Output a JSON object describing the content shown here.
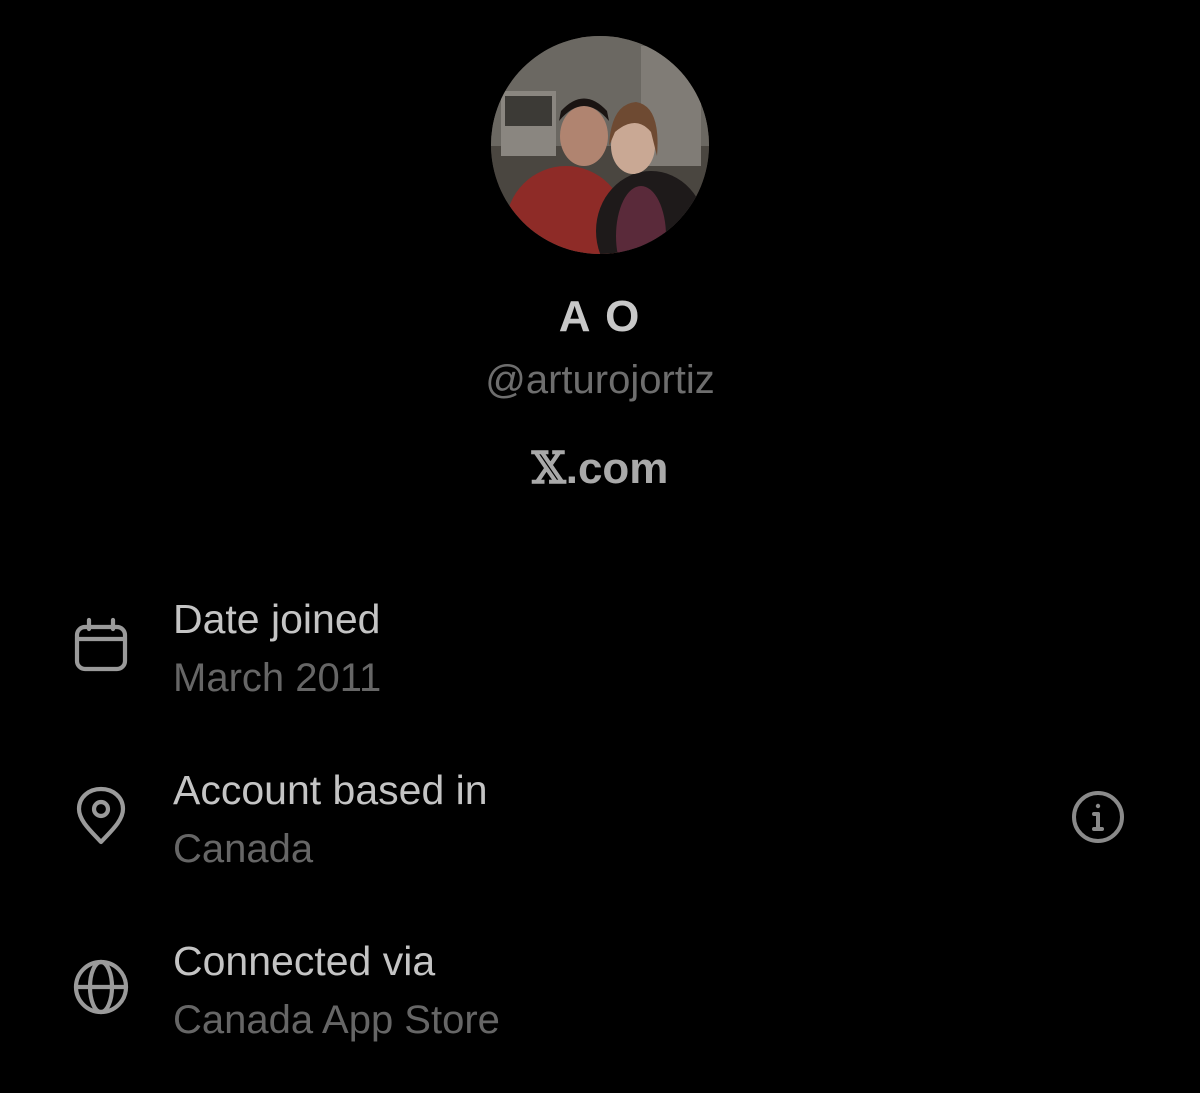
{
  "profile": {
    "avatar": "profile-photo",
    "display_name": "A O",
    "handle": "@arturojortiz",
    "brand_x": "𝕏",
    "brand_suffix": ".com"
  },
  "details": [
    {
      "icon": "calendar-icon",
      "title": "Date joined",
      "value": "March 2011"
    },
    {
      "icon": "location-pin-icon",
      "title": "Account based in",
      "value": "Canada",
      "action_icon": "info-icon"
    },
    {
      "icon": "globe-icon",
      "title": "Connected via",
      "value": "Canada App Store"
    }
  ],
  "colors": {
    "background": "#000000",
    "title_text": "#c4c4c4",
    "secondary_text": "#666666"
  }
}
